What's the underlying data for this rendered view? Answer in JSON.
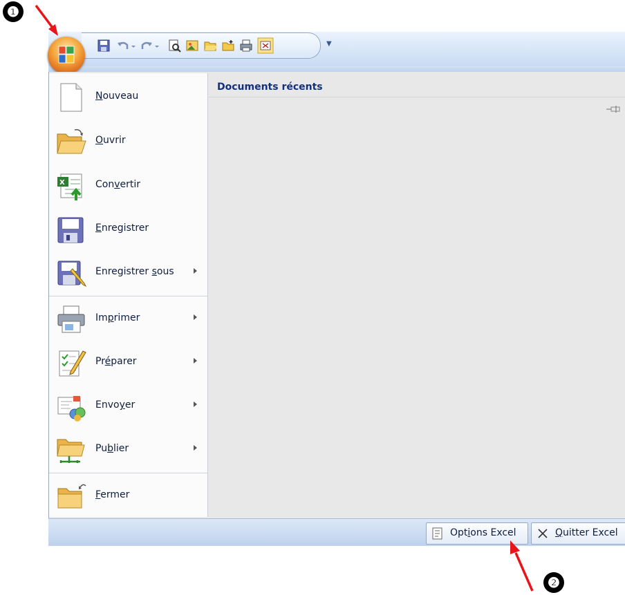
{
  "recent": {
    "title": "Documents récents"
  },
  "menu_items": [
    {
      "pre": "",
      "ul": "N",
      "post": "ouveau",
      "icon": "new-document-icon",
      "arrow": false
    },
    {
      "pre": "",
      "ul": "O",
      "post": "uvrir",
      "icon": "open-folder-icon",
      "arrow": false
    },
    {
      "pre": "Con",
      "ul": "v",
      "post": "ertir",
      "icon": "convert-icon",
      "arrow": false
    },
    {
      "pre": "",
      "ul": "E",
      "post": "nregistrer",
      "icon": "save-icon",
      "arrow": false
    },
    {
      "pre": "Enregistrer ",
      "ul": "s",
      "post": "ous",
      "icon": "save-as-icon",
      "arrow": true
    },
    {
      "pre": "Im",
      "ul": "p",
      "post": "rimer",
      "icon": "printer-icon",
      "arrow": true
    },
    {
      "pre": "Pr",
      "ul": "é",
      "post": "parer",
      "icon": "prepare-icon",
      "arrow": true
    },
    {
      "pre": "Envo",
      "ul": "y",
      "post": "er",
      "icon": "send-icon",
      "arrow": true
    },
    {
      "pre": "Pu",
      "ul": "b",
      "post": "lier",
      "icon": "publish-icon",
      "arrow": true
    },
    {
      "pre": "",
      "ul": "F",
      "post": "ermer",
      "icon": "close-folder-icon",
      "arrow": false
    }
  ],
  "bottom": {
    "options": {
      "pre": "Opt",
      "ul": "i",
      "post": "ons Excel"
    },
    "quit": {
      "pre": "",
      "ul": "Q",
      "post": "uitter Excel"
    }
  },
  "annotations": {
    "step1": "❶",
    "step2": "❷"
  },
  "colors": {
    "arrow": "#e8141a",
    "label": "#15307a"
  }
}
